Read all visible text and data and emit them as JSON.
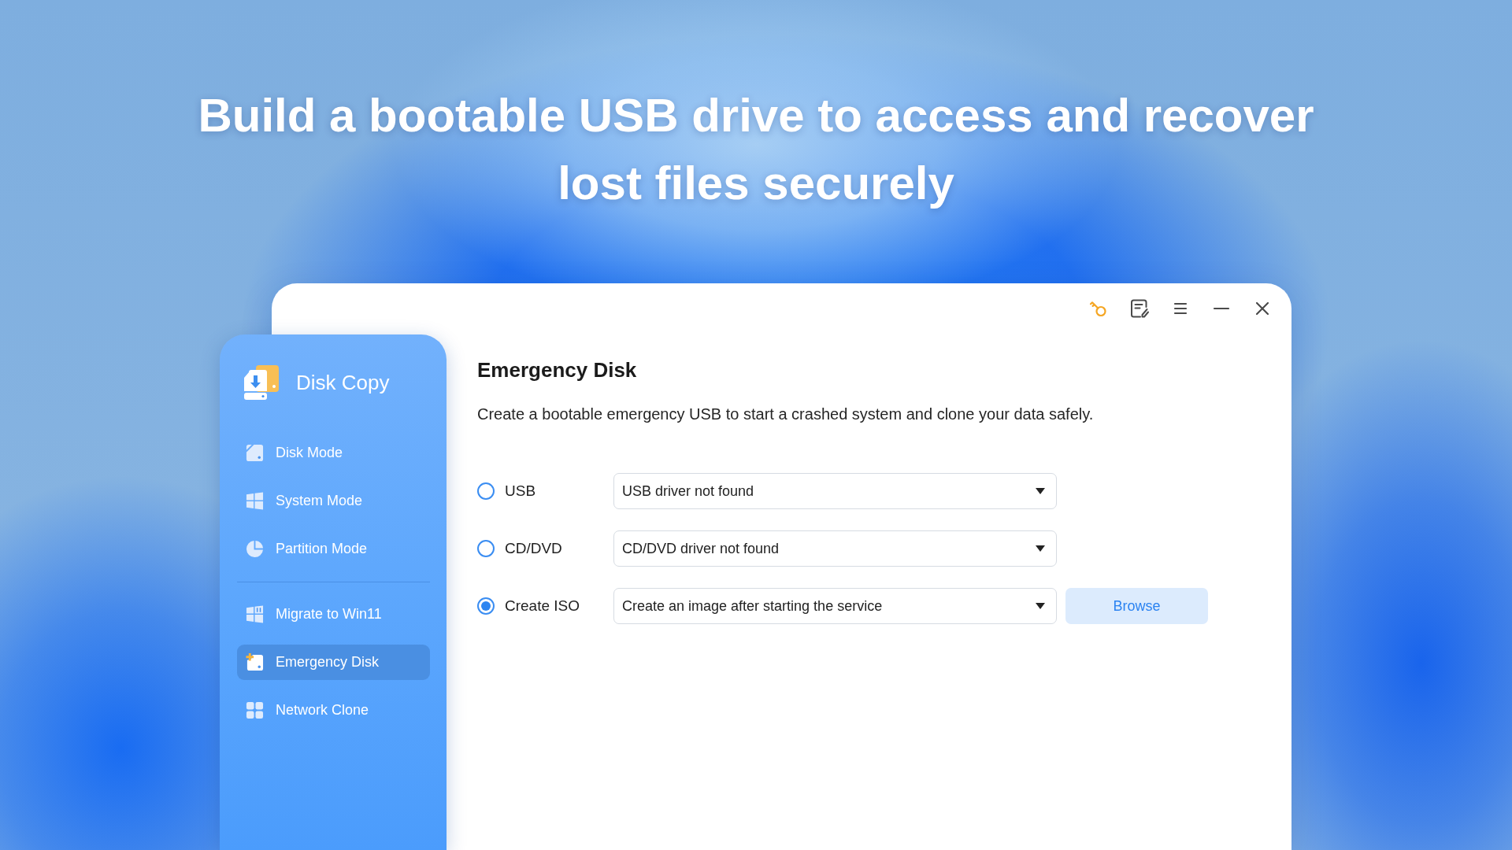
{
  "headline": "Build a bootable USB drive to access and recover lost files securely",
  "sidebar": {
    "title": "Disk Copy",
    "groups": [
      {
        "items": [
          {
            "label": "Disk Mode",
            "selected": false
          },
          {
            "label": "System Mode",
            "selected": false
          },
          {
            "label": "Partition Mode",
            "selected": false
          }
        ]
      },
      {
        "items": [
          {
            "label": "Migrate to Win11",
            "selected": false
          },
          {
            "label": "Emergency Disk",
            "selected": true
          },
          {
            "label": "Network Clone",
            "selected": false
          }
        ]
      }
    ]
  },
  "content": {
    "title": "Emergency Disk",
    "description": "Create a bootable emergency USB to start a crashed system and clone your data safely.",
    "options": [
      {
        "label": "USB",
        "selected": false,
        "dropdown": {
          "value": "USB driver not found"
        }
      },
      {
        "label": "CD/DVD",
        "selected": false,
        "dropdown": {
          "value": "CD/DVD driver not found"
        }
      },
      {
        "label": "Create ISO",
        "selected": true,
        "dropdown": {
          "value": "Create an image after starting the service"
        },
        "button": "Browse"
      }
    ]
  }
}
